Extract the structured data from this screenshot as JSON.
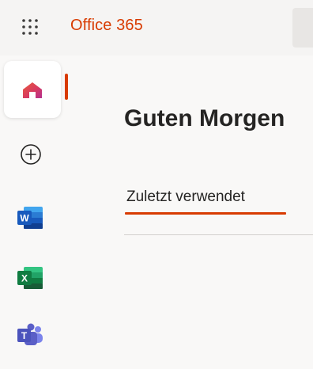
{
  "header": {
    "app_title": "Office 365",
    "app_launcher_icon": "waffle-grid-icon"
  },
  "left_rail": {
    "items": [
      {
        "icon": "home-icon",
        "active": true
      },
      {
        "icon": "create-plus-icon"
      },
      {
        "icon": "word-icon"
      },
      {
        "icon": "excel-icon"
      },
      {
        "icon": "teams-icon"
      }
    ]
  },
  "main": {
    "greeting": "Guten Morgen",
    "tabs": [
      {
        "label": "Zuletzt verwendet",
        "selected": true
      }
    ]
  },
  "colors": {
    "brand": "#d83b01",
    "word": "#185abd",
    "excel": "#107c41",
    "teams": "#5b5fc7"
  }
}
